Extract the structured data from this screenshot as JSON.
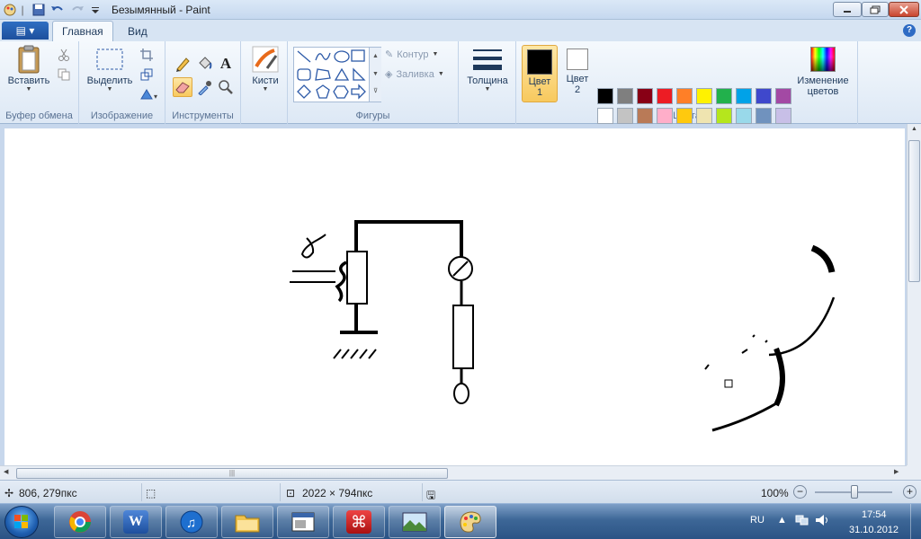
{
  "window": {
    "title": "Безымянный - Paint"
  },
  "tabs": {
    "file": "▤ ▾",
    "home": "Главная",
    "view": "Вид",
    "help": "?"
  },
  "ribbon": {
    "clipboard": {
      "label": "Буфер обмена",
      "paste": "Вставить"
    },
    "image": {
      "label": "Изображение",
      "select": "Выделить"
    },
    "tools": {
      "label": "Инструменты"
    },
    "brushes": {
      "label": "Кисти"
    },
    "shapes": {
      "label": "Фигуры",
      "outline": "Контур",
      "fill": "Заливка"
    },
    "size": {
      "label": "Толщина"
    },
    "colors": {
      "label": "Цвета",
      "color1_line1": "Цвет",
      "color1_line2": "1",
      "color2_line1": "Цвет",
      "color2_line2": "2",
      "edit_line1": "Изменение",
      "edit_line2": "цветов",
      "palette_row1": [
        "#000000",
        "#7f7f7f",
        "#880015",
        "#ed1c24",
        "#ff7f27",
        "#fff200",
        "#22b14c",
        "#00a2e8",
        "#3f48cc",
        "#a349a4"
      ],
      "palette_row2": [
        "#ffffff",
        "#c3c3c3",
        "#b97a57",
        "#ffaec9",
        "#ffc90e",
        "#efe4b0",
        "#b5e61d",
        "#99d9ea",
        "#7092be",
        "#c8bfe7"
      ]
    }
  },
  "drawing": {
    "gamma_label": "γ"
  },
  "status": {
    "cursor": "806, 279пкс",
    "size": "2022 × 794пкс",
    "zoom": "100%"
  },
  "taskbar": {
    "apps": [
      "chrome-icon",
      "word-icon",
      "itunes-icon",
      "explorer-icon",
      "window-icon",
      "acrobat-icon",
      "photos-icon",
      "paint-icon"
    ],
    "lang": "RU",
    "time": "17:54",
    "date": "31.10.2012"
  }
}
